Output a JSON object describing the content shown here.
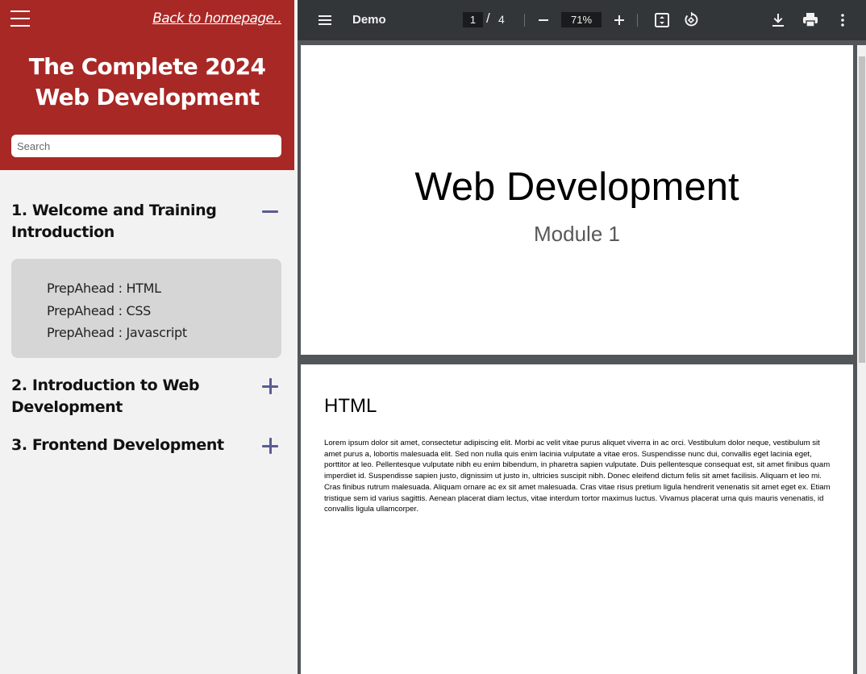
{
  "sidebar": {
    "back_link": "Back to homepage..",
    "course_title": "The Complete 2024 Web Development",
    "search_placeholder": "Search",
    "sections": [
      {
        "title": "1. Welcome and Training Introduction",
        "expanded": true,
        "items": [
          "PrepAhead : HTML",
          "PrepAhead : CSS",
          "PrepAhead : Javascript"
        ]
      },
      {
        "title": "2. Introduction to Web Development",
        "expanded": false
      },
      {
        "title": "3. Frontend Development",
        "expanded": false
      }
    ]
  },
  "viewer": {
    "doc_name": "Demo",
    "current_page": "1",
    "page_separator": "/",
    "total_pages": "4",
    "zoom": "71%",
    "pages": [
      {
        "title": "Web Development",
        "subtitle": "Module 1"
      },
      {
        "title": "HTML",
        "body": "Lorem ipsum dolor sit amet, consectetur adipiscing elit. Morbi ac velit vitae purus aliquet viverra in ac orci. Vestibulum dolor neque, vestibulum sit amet purus a, lobortis malesuada elit. Sed non nulla quis enim lacinia vulputate a vitae eros. Suspendisse nunc dui, convallis eget lacinia eget, porttitor at leo. Pellentesque vulputate nibh eu enim bibendum, in pharetra sapien vulputate. Duis pellentesque consequat est, sit amet finibus quam imperdiet id. Suspendisse sapien justo, dignissim ut justo in, ultricies suscipit nibh. Donec eleifend dictum felis sit amet facilisis. Aliquam et leo mi. Cras finibus rutrum malesuada. Aliquam ornare ac ex sit amet malesuada. Cras vitae risus pretium ligula hendrerit venenatis sit amet eget ex. Etiam tristique sem id varius sagittis. Aenean placerat diam lectus, vitae interdum tortor maximus luctus. Vivamus placerat urna quis mauris venenatis, id convallis ligula ullamcorper."
      }
    ]
  },
  "colors": {
    "header_red": "#a82825",
    "toggle_purple": "#5b5b92",
    "toolbar_dark": "#323639",
    "viewer_bg": "#525659"
  },
  "icons": {
    "sidebar_menu": "hamburger-icon",
    "expand": "plus-icon",
    "collapse": "minus-icon",
    "viewer_menu": "menu-icon",
    "zoom_out": "minus-icon",
    "zoom_in": "plus-icon",
    "fit": "fit-to-page-icon",
    "rotate": "rotate-icon",
    "download": "download-icon",
    "print": "print-icon",
    "more": "more-vert-icon"
  }
}
